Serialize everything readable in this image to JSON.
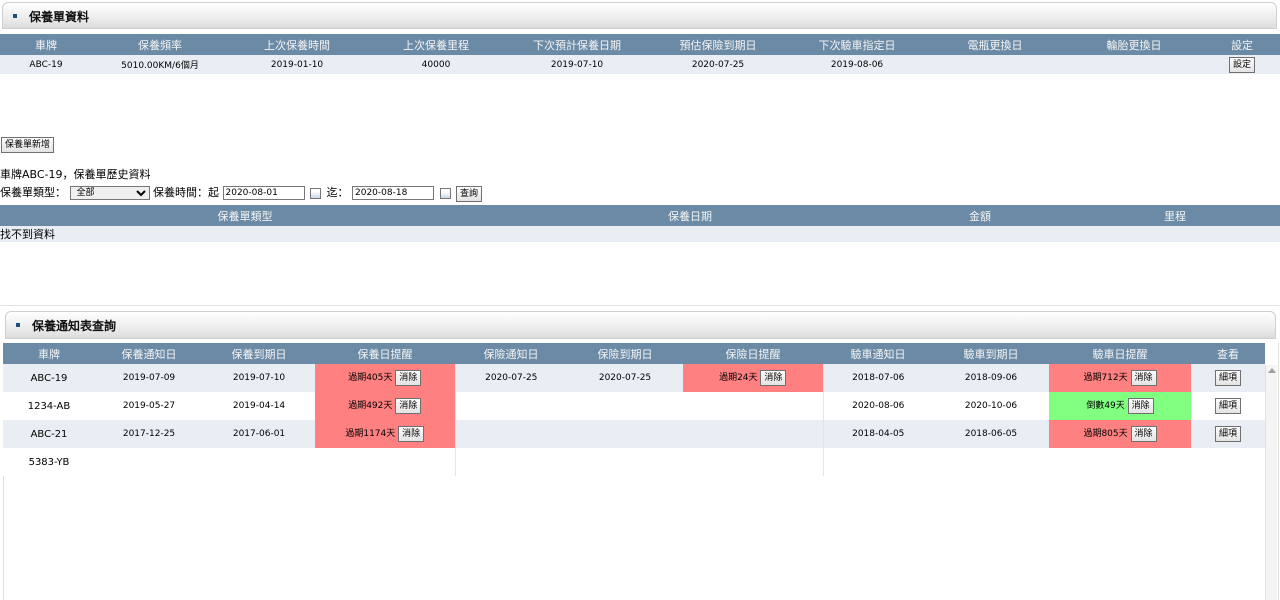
{
  "maintenance_panel": {
    "title": "保養單資料",
    "headers": [
      "車牌",
      "保養頻率",
      "上次保養時間",
      "上次保養里程",
      "下次預計保養日期",
      "預估保險到期日",
      "下次驗車指定日",
      "電瓶更換日",
      "輪胎更換日",
      "設定"
    ],
    "row": {
      "plate": "ABC-19",
      "frequency": "5010.00KM/6個月",
      "last_service_date": "2019-01-10",
      "last_service_km": "40000",
      "next_service_date": "2019-07-10",
      "insurance_expiry": "2020-07-25",
      "next_inspection": "2019-08-06",
      "battery_date": "",
      "tire_date": "",
      "settings_label": "設定"
    }
  },
  "add_button_label": "保養單新增",
  "history": {
    "title": "車牌ABC-19，保養單歷史資料",
    "type_label": "保養單類型：",
    "type_selected": "全部",
    "time_label": "保養時間：起",
    "from_date": "2020-08-01",
    "to_label": "迄：",
    "to_date": "2020-08-18",
    "query_label": "查詢",
    "headers": [
      "保養單類型",
      "保養日期",
      "金額",
      "里程"
    ],
    "empty_text": "找不到資料"
  },
  "notify_panel": {
    "title": "保養通知表查詢",
    "headers": [
      "車牌",
      "保養通知日",
      "保養到期日",
      "保養日提醒",
      "保險通知日",
      "保險到期日",
      "保險日提醒",
      "驗車通知日",
      "驗車到期日",
      "驗車日提醒",
      "查看"
    ],
    "clear_label": "消除",
    "detail_label": "細項",
    "rows": [
      {
        "plate": "ABC-19",
        "svc_notify": "2019-07-09",
        "svc_due": "2019-07-10",
        "svc_alert": "過期405天",
        "svc_color": "#ff8080",
        "ins_notify": "2020-07-25",
        "ins_due": "2020-07-25",
        "ins_alert": "過期24天",
        "ins_color": "#ff8080",
        "insp_notify": "2018-07-06",
        "insp_due": "2018-09-06",
        "insp_alert": "過期712天",
        "insp_color": "#ff8080"
      },
      {
        "plate": "1234-AB",
        "svc_notify": "2019-05-27",
        "svc_due": "2019-04-14",
        "svc_alert": "過期492天",
        "svc_color": "#ff8080",
        "ins_notify": "",
        "ins_due": "",
        "ins_alert": "",
        "ins_color": "",
        "insp_notify": "2020-08-06",
        "insp_due": "2020-10-06",
        "insp_alert": "倒數49天",
        "insp_color": "#80ff80"
      },
      {
        "plate": "ABC-21",
        "svc_notify": "2017-12-25",
        "svc_due": "2017-06-01",
        "svc_alert": "過期1174天",
        "svc_color": "#ff8080",
        "ins_notify": "",
        "ins_due": "",
        "ins_alert": "",
        "ins_color": "",
        "insp_notify": "2018-04-05",
        "insp_due": "2018-06-05",
        "insp_alert": "過期805天",
        "insp_color": "#ff8080"
      },
      {
        "plate": "5383-YB",
        "svc_notify": "",
        "svc_due": "",
        "svc_alert": "",
        "svc_color": "",
        "ins_notify": "",
        "ins_due": "",
        "ins_alert": "",
        "ins_color": "",
        "insp_notify": "",
        "insp_due": "",
        "insp_alert": "",
        "insp_color": ""
      }
    ]
  }
}
